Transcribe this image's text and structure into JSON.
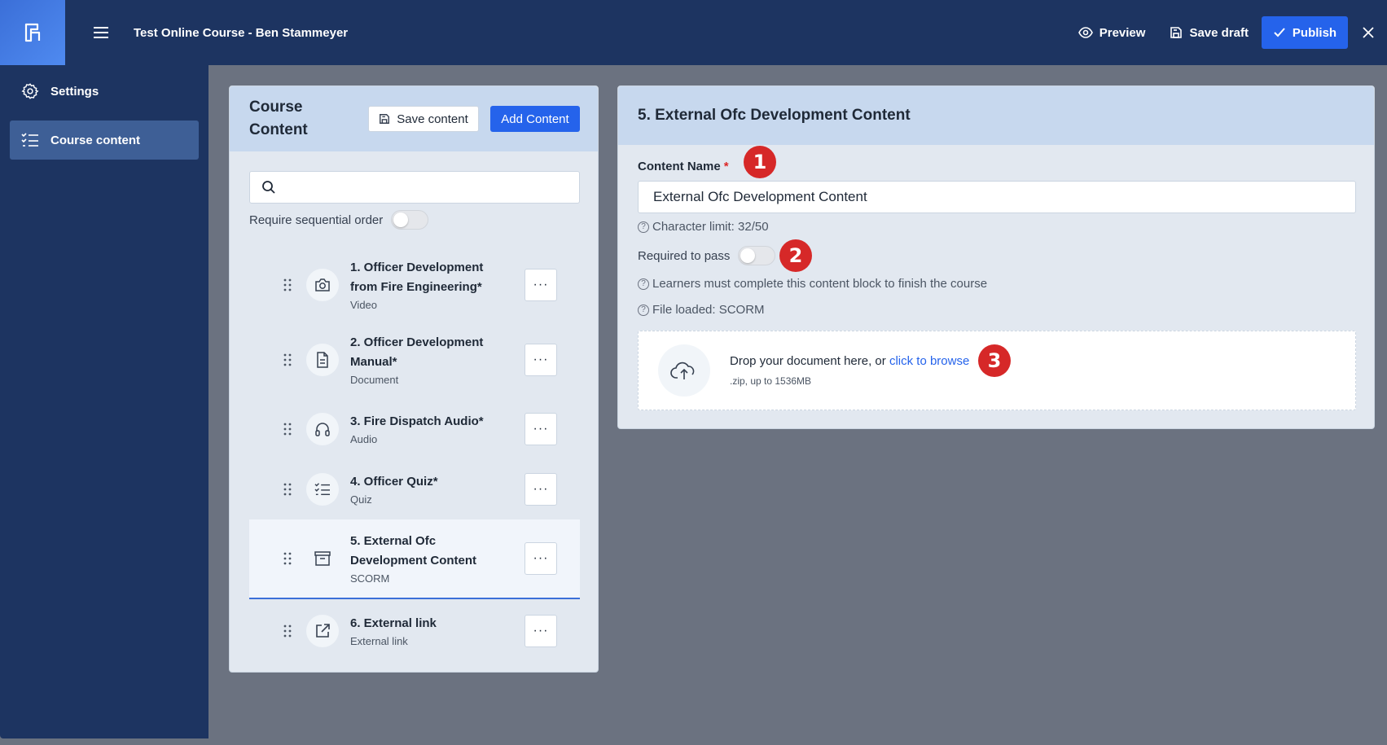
{
  "header": {
    "course_title": "Test Online Course - Ben Stammeyer",
    "preview_label": "Preview",
    "save_draft_label": "Save draft",
    "publish_label": "Publish"
  },
  "sidebar": {
    "items": [
      {
        "label": "Settings",
        "icon": "gear-icon",
        "active": false
      },
      {
        "label": "Course content",
        "icon": "checklist-icon",
        "active": true
      }
    ]
  },
  "course_content": {
    "title": "Course Content",
    "save_content_label": "Save content",
    "add_content_label": "Add Content",
    "search_placeholder": "",
    "sequential_label": "Require sequential order",
    "sequential_on": false,
    "items": [
      {
        "title": "1. Officer Development from Fire Engineering*",
        "type": "Video",
        "icon": "camera-icon"
      },
      {
        "title": "2. Officer Development Manual*",
        "type": "Document",
        "icon": "document-icon"
      },
      {
        "title": "3. Fire Dispatch Audio*",
        "type": "Audio",
        "icon": "headphones-icon"
      },
      {
        "title": "4. Officer Quiz*",
        "type": "Quiz",
        "icon": "checklist-icon"
      },
      {
        "title": "5. External Ofc Development Content",
        "type": "SCORM",
        "icon": "archive-icon",
        "selected": true
      },
      {
        "title": "6. External link",
        "type": "External link",
        "icon": "external-link-icon"
      }
    ],
    "more_label": "···"
  },
  "editor": {
    "title": "5. External Ofc Development Content",
    "content_name_label": "Content Name",
    "required_star": "*",
    "content_name_value": "External Ofc Development Content",
    "char_limit": "Character limit: 32/50",
    "required_to_pass_label": "Required to pass",
    "required_to_pass_on": false,
    "learners_hint": "Learners must complete this content block to finish the course",
    "file_loaded": "File loaded: SCORM",
    "drop_text": "Drop your document here, or ",
    "browse_link": "click to browse",
    "drop_sub": ".zip, up to 1536MB",
    "hint_glyph": "?"
  },
  "badges": [
    "1",
    "2",
    "3"
  ],
  "colors": {
    "nav_bg": "#1d3461",
    "accent": "#2563eb",
    "badge": "#d62828"
  }
}
